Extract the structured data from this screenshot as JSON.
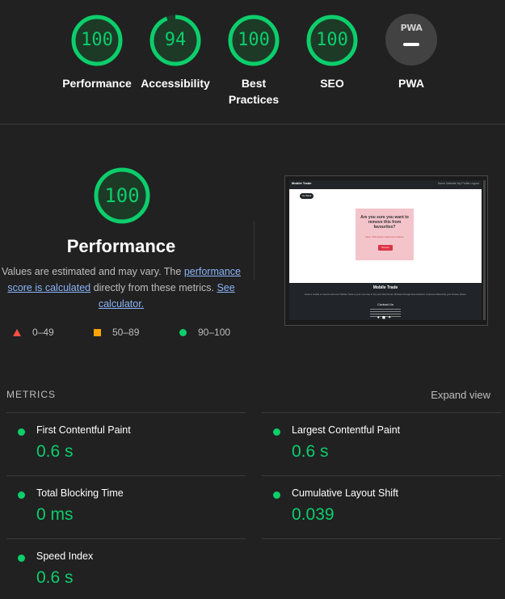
{
  "categories": [
    {
      "score": "100",
      "label": "Performance",
      "value": 100
    },
    {
      "score": "94",
      "label": "Accessibility",
      "value": 94
    },
    {
      "score": "100",
      "label": "Best Practices",
      "value": 100
    },
    {
      "score": "100",
      "label": "SEO",
      "value": 100
    }
  ],
  "pwa": {
    "badge": "PWA",
    "label": "PWA"
  },
  "performance": {
    "score": "100",
    "title": "Performance",
    "desc_prefix": "Values are estimated and may vary. The ",
    "desc_link1": "performance score is calculated",
    "desc_mid": " directly from these metrics. ",
    "desc_link2": "See calculator.",
    "legend": {
      "fail": "0–49",
      "average": "50–89",
      "pass": "90–100"
    }
  },
  "thumbnail": {
    "brand": "Mobile Trade",
    "nav_links": "Home  Website  My Profile  Logout",
    "back": "Go Back",
    "question": "Are you sure you want to remove this from favourites?",
    "subtext": "Note: This action cannot be undone",
    "button": "Remove",
    "footer_title": "Mobile Trade",
    "footer_desc": "Have a mobile or need to sell one? Mobile Trade is your one stop to buy and sell phones. Browse through wide selection of phones filtered by your chosen phone",
    "contact": "Contact Us"
  },
  "metrics": {
    "heading": "METRICS",
    "expand": "Expand view",
    "items": [
      {
        "name": "First Contentful Paint",
        "value": "0.6 s"
      },
      {
        "name": "Largest Contentful Paint",
        "value": "0.6 s"
      },
      {
        "name": "Total Blocking Time",
        "value": "0 ms"
      },
      {
        "name": "Cumulative Layout Shift",
        "value": "0.039"
      },
      {
        "name": "Speed Index",
        "value": "0.6 s"
      }
    ]
  },
  "colors": {
    "pass": "#0cce6b",
    "average": "#ffa400",
    "fail": "#ff4e42",
    "link": "#8ab4f8"
  }
}
